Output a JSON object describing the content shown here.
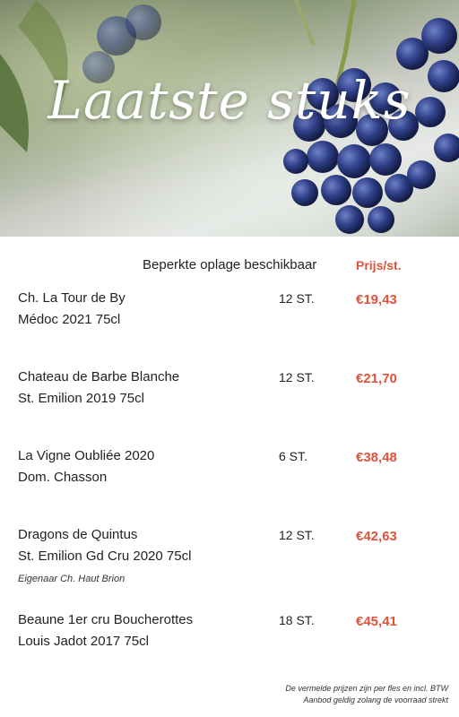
{
  "header": {
    "title": "Laatste stuks"
  },
  "table": {
    "subtitle": "Beperkte oplage beschikbaar",
    "price_header": "Prijs/st."
  },
  "items": [
    {
      "line1": "Ch. La Tour de By",
      "line2": "Médoc 2021 75cl",
      "qty": "12 ST.",
      "price": "€19,43"
    },
    {
      "line1": "Chateau de Barbe Blanche",
      "line2": "St. Emilion 2019 75cl",
      "qty": "12 ST.",
      "price": "€21,70"
    },
    {
      "line1": "La Vigne Oubliée 2020",
      "line2": "Dom. Chasson",
      "qty": "6 ST.",
      "price": "€38,48"
    },
    {
      "line1": "Dragons de Quintus",
      "line2": "St. Emilion Gd Cru 2020 75cl",
      "qty": "12 ST.",
      "price": "€42,63"
    },
    {
      "line1": "Beaune 1er cru Boucherottes",
      "line2": "Louis Jadot 2017 75cl",
      "qty": "18 ST.",
      "price": "€45,41"
    }
  ],
  "note": "Eigenaar Ch. Haut Brion",
  "footer": {
    "line1": "De vermelde prijzen zijn per fles en incl. BTW",
    "line2": "Aanbod geldig zolang de voorraad strekt"
  },
  "colors": {
    "price": "#e0523a",
    "grape": "#2c3a78"
  }
}
